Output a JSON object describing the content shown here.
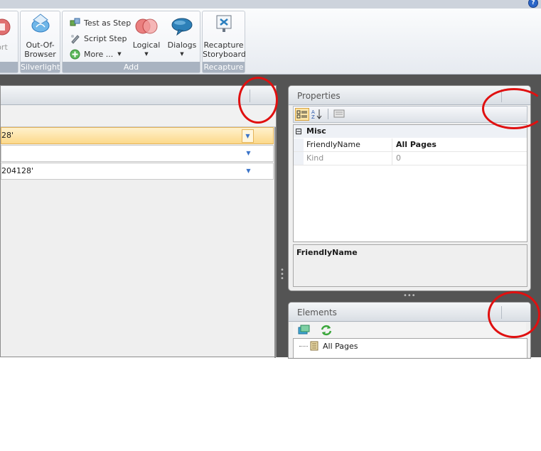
{
  "ribbon": {
    "partial_button_label": "ort",
    "groups": [
      {
        "label": "Silverlight",
        "buttons": [
          {
            "label_line1": "Out-Of-",
            "label_line2": "Browser"
          }
        ]
      },
      {
        "label": "Add",
        "small_buttons": [
          {
            "label": "Test as Step"
          },
          {
            "label": "Script Step"
          },
          {
            "label": "More ..."
          }
        ],
        "big_buttons": [
          {
            "label": "Logical"
          },
          {
            "label": "Dialogs"
          }
        ]
      },
      {
        "label": "Recapture",
        "buttons": [
          {
            "label_line1": "Recapture",
            "label_line2": "Storyboard"
          }
        ]
      }
    ],
    "help_glyph": "?"
  },
  "left_panel": {
    "rows": [
      {
        "text": "28'",
        "selected": true
      },
      {
        "text": "",
        "selected": false
      },
      {
        "text": "204128'",
        "selected": false
      }
    ]
  },
  "properties": {
    "title": "Properties",
    "category": "Misc",
    "collapse_glyph": "⊟",
    "items": [
      {
        "name": "FriendlyName",
        "value": "All Pages",
        "enabled": true
      },
      {
        "name": "Kind",
        "value": "0",
        "enabled": false
      }
    ],
    "description_title": "FriendlyName"
  },
  "elements": {
    "title": "Elements",
    "tree_items": [
      {
        "label": "All Pages"
      }
    ]
  },
  "colors": {
    "selected_row": "#fde4a8",
    "annotation": "#e01010",
    "ribbon_label": "#a9b3c1"
  }
}
